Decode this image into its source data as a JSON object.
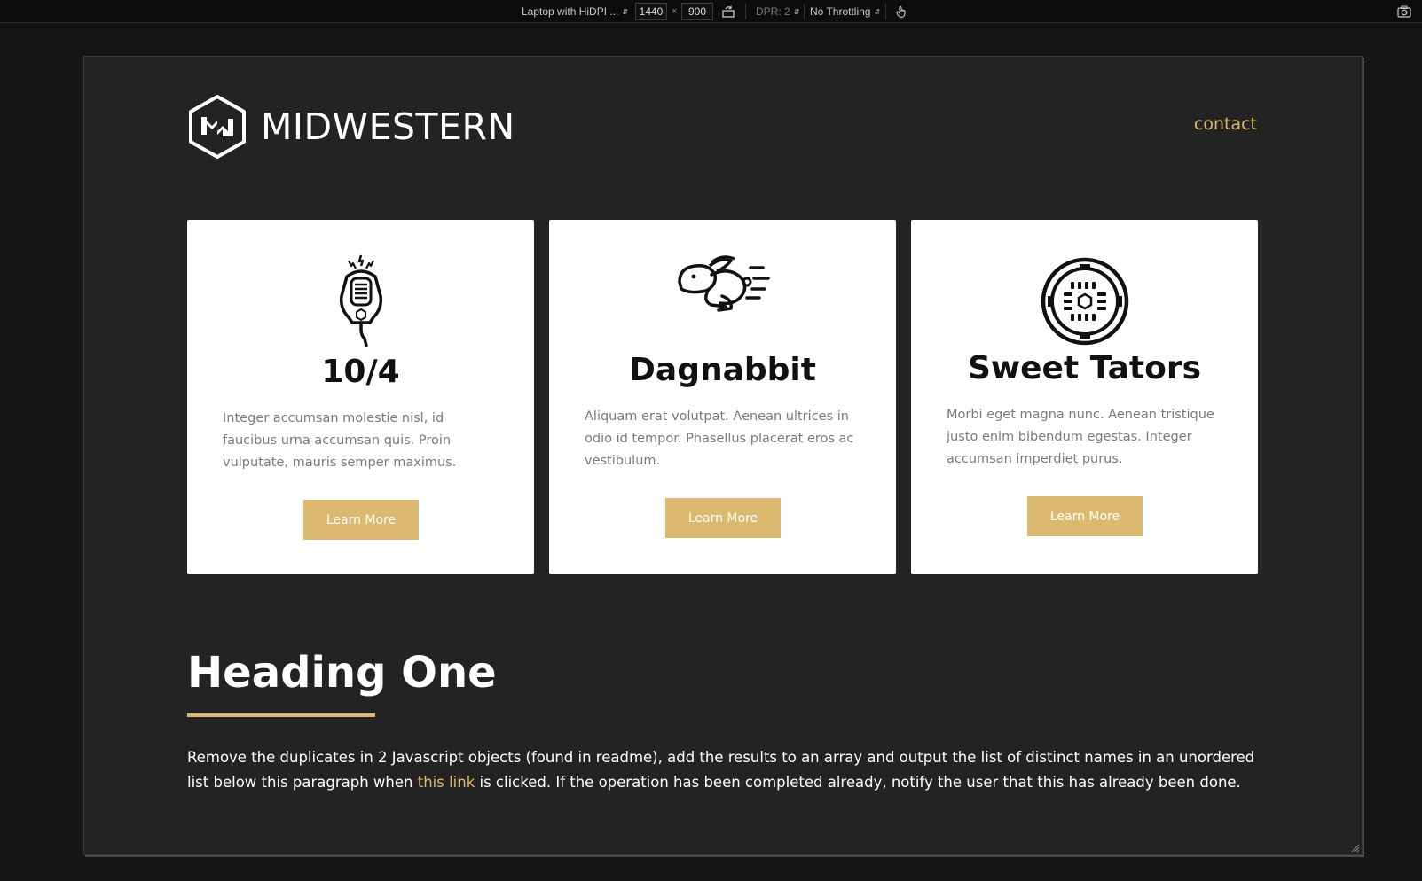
{
  "devtools": {
    "device_label": "Laptop with HiDPI ...",
    "width": "1440",
    "times": "×",
    "height": "900",
    "dpr_label": "DPR: 2",
    "throttle_label": "No Throttling",
    "icons": [
      "rotate-icon",
      "touch-icon",
      "screenshot-icon"
    ]
  },
  "header": {
    "brand": "MIDWESTERN",
    "contact_label": "contact"
  },
  "cards": [
    {
      "icon": "cb-radio-mic-icon",
      "title": "10/4",
      "text": "Integer accumsan molestie nisl, id faucibus urna accumsan quis. Proin vulputate, mauris semper maximus.",
      "button": "Learn More"
    },
    {
      "icon": "running-rabbit-icon",
      "title": "Dagnabbit",
      "text": "Aliquam erat volutpat. Aenean ultrices in odio id tempor. Phasellus placerat eros ac vestibulum.",
      "button": "Learn More"
    },
    {
      "icon": "manhole-cover-icon",
      "title": "Sweet Tators",
      "text": "Morbi eget magna nunc. Aenean tristique justo enim bibendum egestas. Integer accumsan imperdiet purus.",
      "button": "Learn More"
    }
  ],
  "section": {
    "heading": "Heading One",
    "para_before": "Remove the duplicates in 2 Javascript objects (found in readme), add the results to an array and output the list of distinct names in an unordered list below this paragraph when ",
    "link": "this link",
    "para_after": " is clicked. If the operation has been completed already, notify the user that this has already been done."
  },
  "colors": {
    "accent": "#dbb96f",
    "page_bg": "#232323",
    "card_bg": "#ffffff",
    "body_text_grey": "#7a7a7a"
  }
}
